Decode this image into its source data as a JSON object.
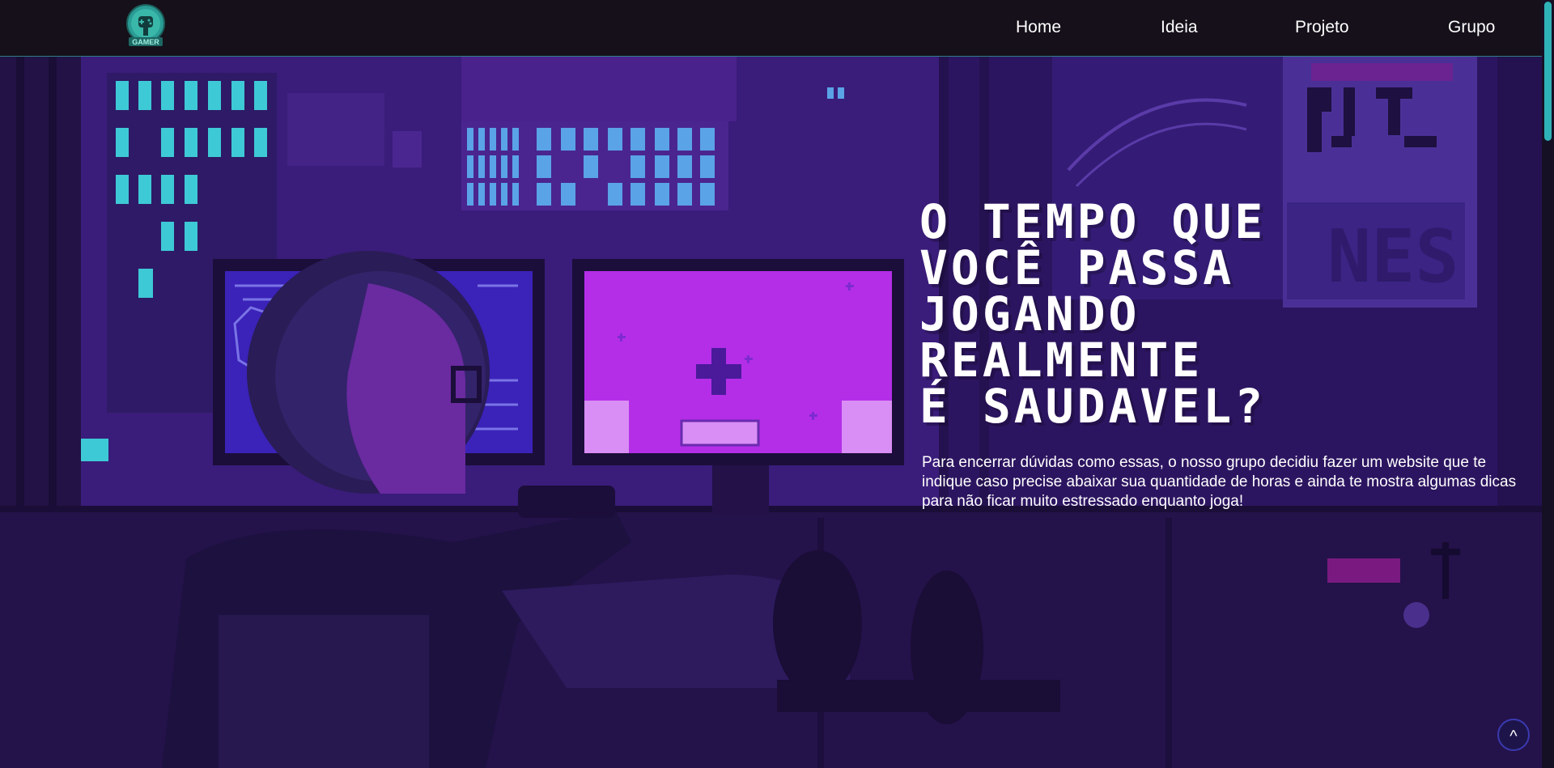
{
  "logo": {
    "text": "GAMER",
    "icon": "gamer-controller-logo-icon"
  },
  "nav": {
    "items": [
      {
        "label": "Home"
      },
      {
        "label": "Ideia"
      },
      {
        "label": "Projeto"
      },
      {
        "label": "Grupo"
      }
    ]
  },
  "hero": {
    "title": "O TEMPO QUE\nVOCê PASSA\nJOGANDO\nREALMENTE\né SAUDAVEL?",
    "text": "Para encerrar dúvidas como essas, o nosso grupo decidiu fazer um website que te indique caso precise abaixar sua quantidade de horas e ainda te mostra algumas dicas para não ficar muito estressado enquanto joga!"
  },
  "back_to_top": {
    "label": "^",
    "icon": "chevron-up-icon"
  },
  "colors": {
    "nav_bg": "#151019",
    "accent": "#2fb2b7",
    "hero_bg": "#2f1664",
    "monitor_pink": "#b42ee8",
    "monitor_blue": "#3b22b8"
  }
}
